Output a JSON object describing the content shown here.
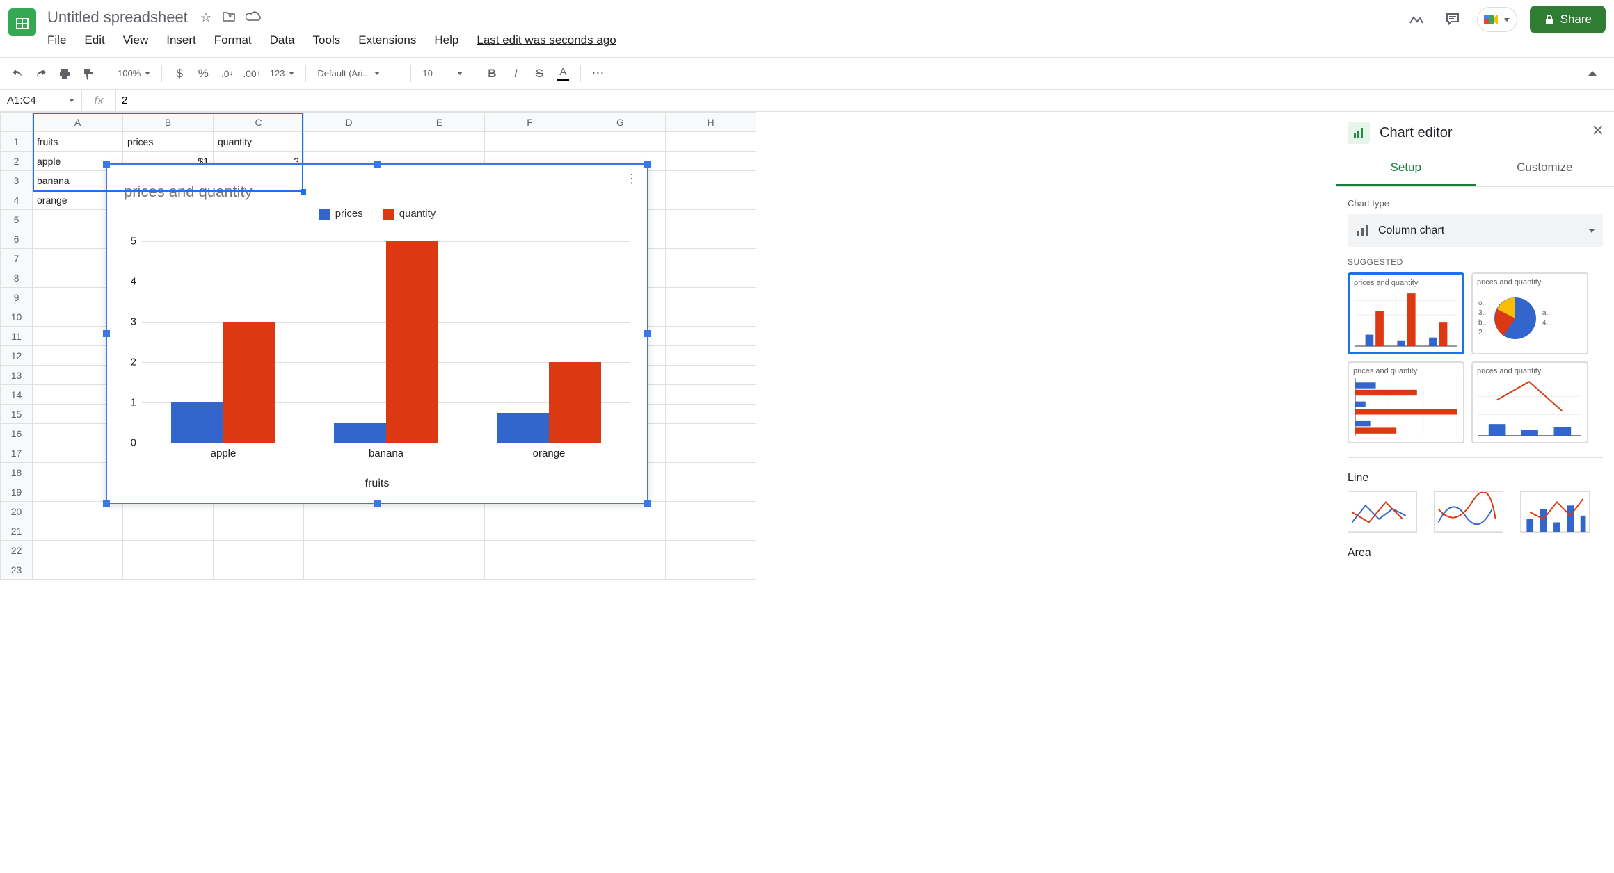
{
  "doc": {
    "title": "Untitled spreadsheet",
    "last_edit": "Last edit was seconds ago"
  },
  "menu": [
    "File",
    "Edit",
    "View",
    "Insert",
    "Format",
    "Data",
    "Tools",
    "Extensions",
    "Help"
  ],
  "share_label": "Share",
  "toolbar": {
    "zoom": "100%",
    "font": "Default (Ari...",
    "font_size": "10",
    "num_format": "123"
  },
  "name_box": "A1:C4",
  "formula_value": "2",
  "columns": [
    "A",
    "B",
    "C",
    "D",
    "E",
    "F",
    "G",
    "H"
  ],
  "rows": 23,
  "cells": {
    "1": {
      "A": "fruits",
      "B": "prices",
      "C": "quantity"
    },
    "2": {
      "A": "apple",
      "B": "$1",
      "C": "3"
    },
    "3": {
      "A": "banana"
    },
    "4": {
      "A": "orange"
    }
  },
  "chart_data": {
    "type": "bar",
    "title": "prices and quantity",
    "xlabel": "fruits",
    "categories": [
      "apple",
      "banana",
      "orange"
    ],
    "series": [
      {
        "name": "prices",
        "color": "#3366cc",
        "values": [
          1,
          0.5,
          0.75
        ]
      },
      {
        "name": "quantity",
        "color": "#dc3912",
        "values": [
          3,
          5,
          2
        ]
      }
    ],
    "yticks": [
      0,
      1,
      2,
      3,
      4,
      5
    ],
    "ylim": [
      0,
      5
    ]
  },
  "editor": {
    "title": "Chart editor",
    "tabs": {
      "setup": "Setup",
      "customize": "Customize"
    },
    "chart_type_label": "Chart type",
    "chart_type_value": "Column chart",
    "suggested_label": "SUGGESTED",
    "suggested_title": "prices and quantity",
    "pie_labels": [
      "o...",
      "3...",
      "b...",
      "2...",
      "a...",
      "4..."
    ],
    "line_label": "Line",
    "area_label": "Area"
  }
}
